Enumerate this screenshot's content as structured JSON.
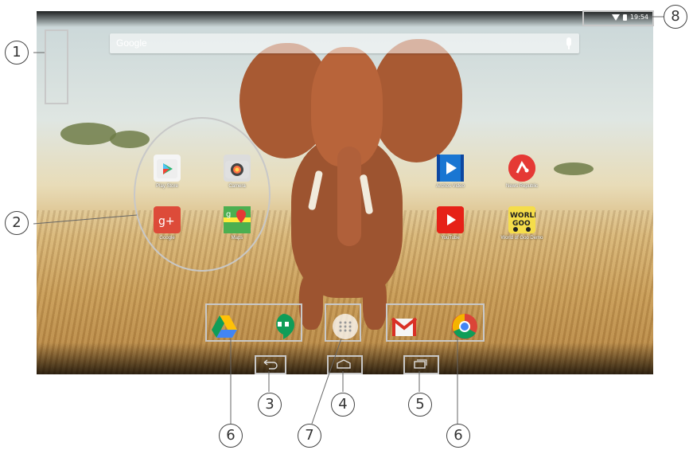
{
  "search": {
    "placeholder": "Google"
  },
  "status": {
    "time": "19:54"
  },
  "apps": [
    {
      "label": "Play Store"
    },
    {
      "label": "Camera"
    },
    {
      "label": "Google"
    },
    {
      "label": "Maps"
    },
    {
      "label": "Archos Video"
    },
    {
      "label": "News Republic"
    },
    {
      "label": "YouTube"
    },
    {
      "label": "World of Goo Demo"
    }
  ],
  "callouts": [
    "1",
    "2",
    "3",
    "4",
    "5",
    "6",
    "7",
    "6",
    "8"
  ],
  "icons": {
    "play_store": "play-store-icon",
    "camera": "camera-icon",
    "google_plus": "google-plus-icon",
    "maps": "maps-icon",
    "archos_video": "archos-video-icon",
    "news_republic": "news-republic-icon",
    "youtube": "youtube-icon",
    "world_of_goo": "world-of-goo-icon",
    "drive": "drive-icon",
    "hangouts": "hangouts-icon",
    "app_drawer": "app-drawer-icon",
    "gmail": "gmail-icon",
    "chrome": "chrome-icon"
  }
}
